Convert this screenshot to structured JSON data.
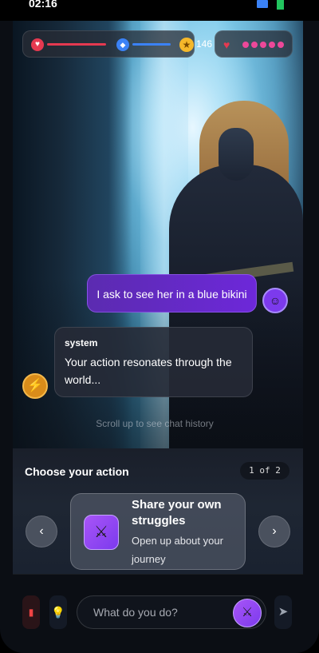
{
  "status_bar": {
    "time": "02:16"
  },
  "hud": {
    "health_icon": "heart-icon",
    "health_color": "#e53950",
    "mana_icon": "gem-icon",
    "mana_color": "#3b82f6",
    "gold_icon": "star-icon",
    "gold": "146",
    "affection_icon": "heart-icon",
    "affection_level": 5,
    "affection_color": "#ec4899"
  },
  "chat": {
    "user_message": "I ask to see her in a blue bikini",
    "system_sender": "system",
    "system_message": "Your action resonates through the world...",
    "scroll_hint": "Scroll up to see chat history"
  },
  "actions": {
    "title": "Choose your action",
    "counter": "1 of 2",
    "card": {
      "icon": "crossed-swords-icon",
      "title": "Share your own struggles",
      "description": "Open up about your journey"
    }
  },
  "composer": {
    "placeholder": "What do you do?"
  },
  "colors": {
    "accent": "#7c3aed",
    "background": "#0b0e14"
  }
}
